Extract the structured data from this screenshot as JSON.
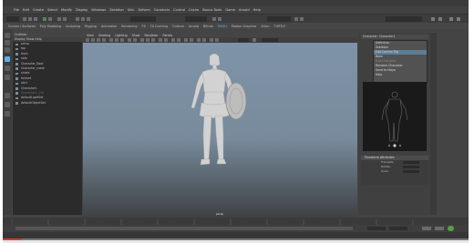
{
  "app": {
    "title": "Autodesk Maya"
  },
  "menubar": [
    "File",
    "Edit",
    "Create",
    "Select",
    "Modify",
    "Display",
    "Windows",
    "Skeleton",
    "Skin",
    "Deform",
    "Constrain",
    "Control",
    "Cache",
    "Bonus Tools",
    "Game",
    "Arnold",
    "Help"
  ],
  "tabs": [
    "Curves / Surfaces",
    "Poly Modeling",
    "Sculpting",
    "Rigging",
    "Animation",
    "Rendering",
    "FX",
    "FX Caching",
    "Custom",
    "Arnold",
    "Bifrost",
    "MASH",
    "Motion Graphics",
    "XGen",
    "TURTLE"
  ],
  "tabs_active_index": 11,
  "outliner": {
    "title": "Outliner",
    "menu": "Display  Show  Help",
    "items": [
      {
        "label": "persp",
        "dim": false
      },
      {
        "label": "top",
        "dim": false
      },
      {
        "label": "front",
        "dim": false
      },
      {
        "label": "side",
        "dim": false
      },
      {
        "label": "Character_Root",
        "dim": false
      },
      {
        "label": "Character_mesh",
        "dim": false
      },
      {
        "label": "shield",
        "dim": false
      },
      {
        "label": "helmet",
        "dim": false
      },
      {
        "label": "skirt",
        "dim": false
      },
      {
        "label": "Character1",
        "dim": false
      },
      {
        "label": "Character1_Ctrl",
        "dim": true
      },
      {
        "label": "defaultLightSet",
        "dim": false
      },
      {
        "label": "defaultObjectSet",
        "dim": false
      }
    ]
  },
  "viewport": {
    "menu": [
      "View",
      "Shading",
      "Lighting",
      "Show",
      "Renderer",
      "Panels"
    ],
    "camera_label": "persp"
  },
  "hik": {
    "character_label": "Character: Character1",
    "menu_items": [
      {
        "label": "Definition",
        "disabled": false,
        "highlight": false
      },
      {
        "label": "Skeleton",
        "disabled": false,
        "highlight": false
      },
      {
        "label": "Edit Control Rig",
        "disabled": false,
        "highlight": true
      },
      {
        "label": "Bake",
        "disabled": false,
        "highlight": false
      },
      {
        "label": "Edit Character",
        "disabled": true,
        "highlight": false
      },
      {
        "label": "Rename Character",
        "disabled": false,
        "highlight": false
      },
      {
        "label": "Send to Maya",
        "disabled": false,
        "highlight": false
      },
      {
        "label": "Help",
        "disabled": false,
        "highlight": false
      }
    ]
  },
  "attributes": {
    "header": "Transform Attributes",
    "rows": [
      "Translate",
      "Rotate",
      "Scale"
    ]
  },
  "colors": {
    "accent": "#5fb2e5",
    "progress": "#e3342f"
  },
  "progress": {
    "fraction": 0.04
  }
}
